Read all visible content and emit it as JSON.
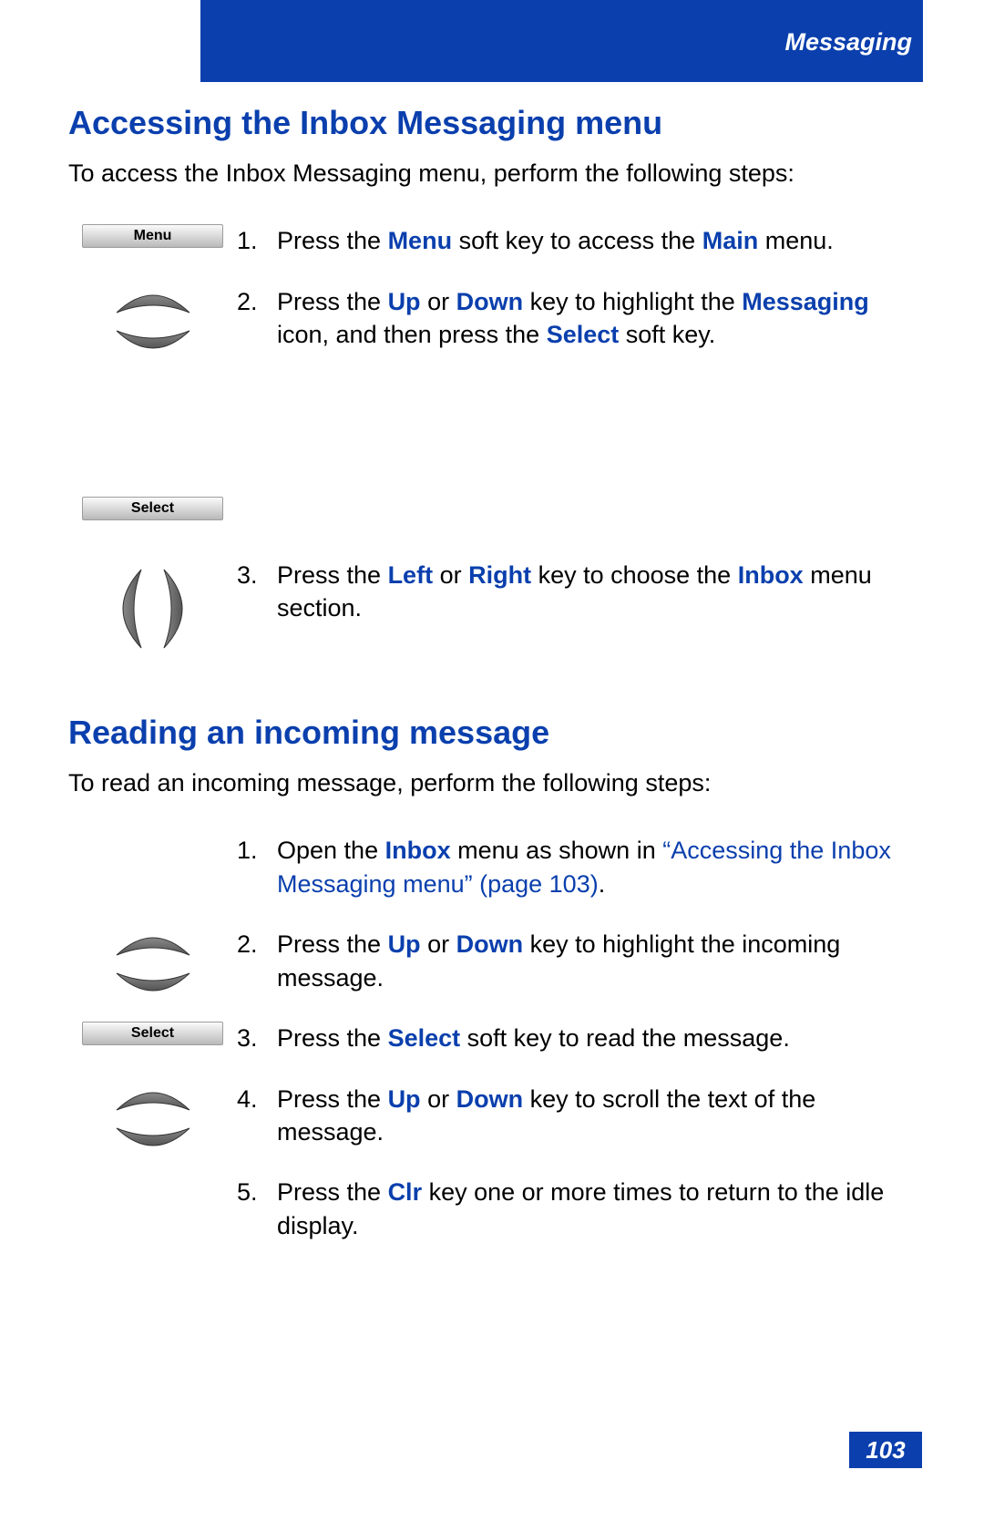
{
  "header": {
    "title": "Messaging"
  },
  "section1": {
    "heading": "Accessing the Inbox Messaging menu",
    "intro": "To access the Inbox Messaging menu, perform the following steps:",
    "softkey1": "Menu",
    "softkey2": "Select",
    "steps": {
      "s1": {
        "num": "1.",
        "pre": "Press the ",
        "k1": "Menu",
        "mid": " soft key to access the ",
        "k2": "Main",
        "post": " menu."
      },
      "s2": {
        "num": "2.",
        "pre": "Press the ",
        "k1": "Up",
        "mid1": " or ",
        "k2": "Down",
        "mid2": " key to highlight the ",
        "k3": "Messaging",
        "mid3": " icon, and then press the ",
        "k4": "Select",
        "post": " soft key."
      },
      "s3": {
        "num": "3.",
        "pre": "Press the ",
        "k1": "Left",
        "mid1": " or ",
        "k2": "Right",
        "mid2": " key to choose the ",
        "k3": "Inbox",
        "post": " menu section."
      }
    }
  },
  "section2": {
    "heading": "Reading an incoming message",
    "intro": "To read an incoming message, perform the following steps:",
    "softkey": "Select",
    "steps": {
      "s1": {
        "num": "1.",
        "pre": "Open the ",
        "k1": "Inbox",
        "mid": " menu as shown in ",
        "link": "“Accessing the Inbox Messaging menu” (page 103)",
        "post": "."
      },
      "s2": {
        "num": "2.",
        "pre": "Press the ",
        "k1": "Up",
        "mid1": " or ",
        "k2": "Down",
        "post": " key to highlight the incoming message."
      },
      "s3": {
        "num": "3.",
        "pre": "Press the ",
        "k1": "Select",
        "post": " soft key to read the message."
      },
      "s4": {
        "num": "4.",
        "pre": "Press the ",
        "k1": "Up",
        "mid1": " or ",
        "k2": "Down",
        "post": " key to scroll the text of the message."
      },
      "s5": {
        "num": "5.",
        "pre": "Press the ",
        "k1": "Clr",
        "post": " key one or more times to return to the idle display."
      }
    }
  },
  "page_number": "103"
}
